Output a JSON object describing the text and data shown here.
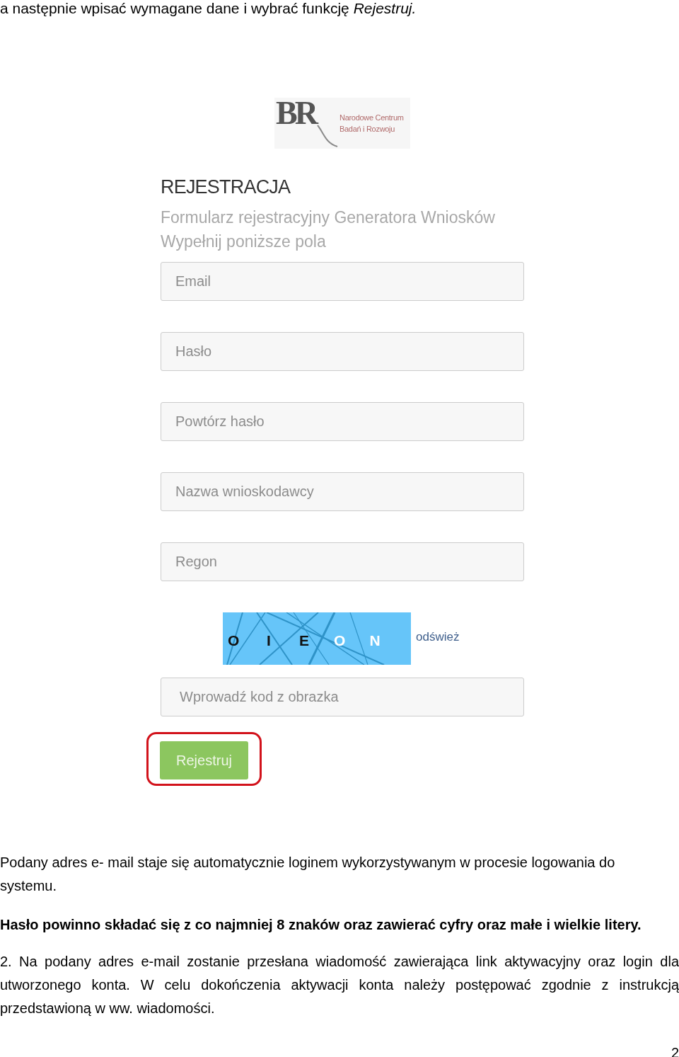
{
  "intro": {
    "text": "a następnie wpisać wymagane dane i wybrać funkcję *Rejestruj.*"
  },
  "form": {
    "logo": {
      "mark": "BR",
      "name_lines": [
        "Narodowe Centrum",
        "Badań i Rozwoju"
      ]
    },
    "title": "REJESTRACJA",
    "subtitle": "Formularz rejestracyjny Generatora Wniosków",
    "instruction": "Wypełnij poniższe pola",
    "fields": [
      {
        "placeholder": "Email"
      },
      {
        "placeholder": "Hasło"
      },
      {
        "placeholder": "Powtórz hasło"
      },
      {
        "placeholder": "Nazwa wnioskodawcy"
      },
      {
        "placeholder": "Regon"
      }
    ],
    "captcha": {
      "characters": [
        {
          "char": "O",
          "color": "#111111"
        },
        {
          "char": "I",
          "color": "#111111"
        },
        {
          "char": "E",
          "color": "#111111"
        },
        {
          "char": "O",
          "color": "#ffffff"
        },
        {
          "char": "N",
          "color": "#ffffff"
        }
      ],
      "refresh_link": "odśwież"
    },
    "captcha_field": {
      "placeholder": "Wprowadź kod z obrazka"
    },
    "submit_button": {
      "label": "Rejestruj",
      "highlighted": true
    }
  },
  "paragraphs": [
    {
      "kind": "plain",
      "text": "Podany adres e- mail staje się automatycznie loginem wykorzystywanym w procesie logowania do systemu."
    },
    {
      "kind": "bold",
      "text": "Hasło powinno składać się z co najmniej 8 znaków oraz zawierać cyfry oraz małe i wielkie litery."
    },
    {
      "kind": "justified",
      "text": "2. Na podany adres e-mail zostanie przesłana wiadomość zawierająca link aktywacyjny oraz login dla utworzonego konta. W celu dokończenia aktywacji konta należy postępować zgodnie z instrukcją przedstawioną w ww. wiadomości."
    }
  ],
  "page_number": "2"
}
